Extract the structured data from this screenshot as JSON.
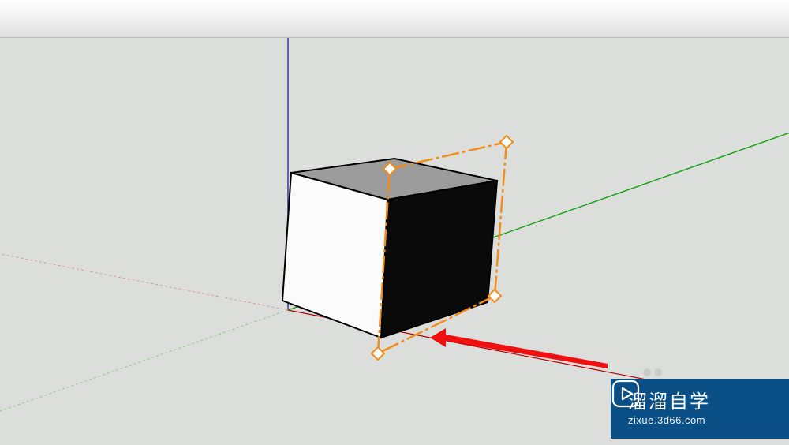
{
  "toolbar": {
    "title": ""
  },
  "viewport": {
    "axes": {
      "z_color": "#2a2aa8",
      "x_color_pos": "#b00000",
      "x_color_neg": "#d99",
      "y_color_pos": "#10a010",
      "y_color_neg": "#8ec98e"
    },
    "cube": {
      "front_face_color": "#fbfbfb",
      "right_face_color": "#0a0a0a",
      "top_face_color": "#9c9c9c",
      "edge_color": "#000000"
    },
    "section_plane": {
      "color": "#f28c1a",
      "glyph": "section-plane"
    },
    "annotation_arrow": {
      "color": "#f01010"
    }
  },
  "watermark": {
    "title": "溜溜自学",
    "url": "zixue.3d66.com",
    "bg_color": "#0a4f86",
    "icon": "play-outline-icon"
  }
}
